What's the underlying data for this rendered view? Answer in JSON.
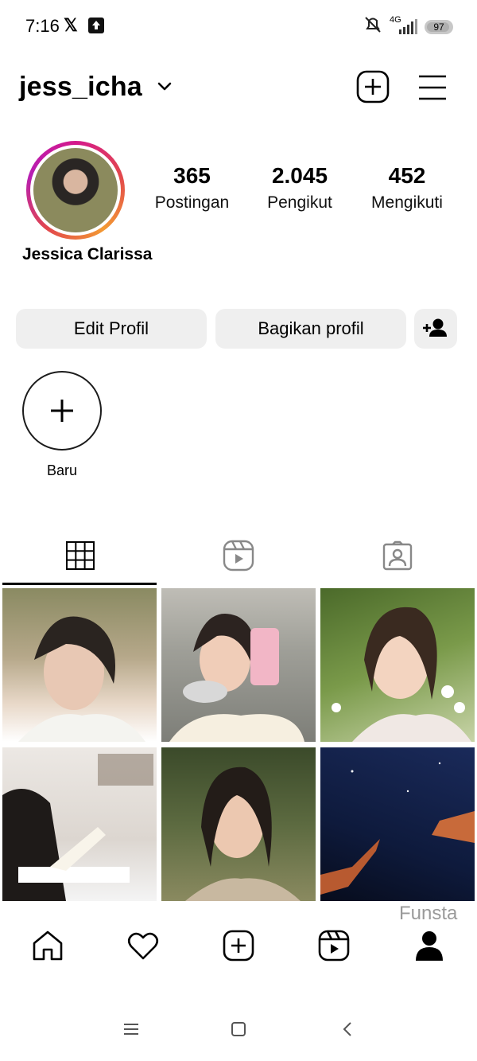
{
  "status_bar": {
    "time": "7:16",
    "x_glyph": "𝕏",
    "network": "4G",
    "battery": "97",
    "icons": [
      "x-icon",
      "upload-notification-icon",
      "mute-icon",
      "signal-icon",
      "battery-icon"
    ]
  },
  "header": {
    "username": "jess_icha"
  },
  "profile": {
    "display_name": "Jessica Clarissa",
    "stats": [
      {
        "value": "365",
        "label": "Postingan"
      },
      {
        "value": "2.045",
        "label": "Pengikut"
      },
      {
        "value": "452",
        "label": "Mengikuti"
      }
    ]
  },
  "actions": {
    "edit_label": "Edit Profil",
    "share_label": "Bagikan profil"
  },
  "highlights": {
    "new_label": "Baru"
  },
  "tabs": [
    "grid-icon",
    "reels-icon",
    "tagged-icon"
  ],
  "grid": {
    "posts": [
      {
        "name": "post-1"
      },
      {
        "name": "post-2"
      },
      {
        "name": "post-3"
      },
      {
        "name": "post-4"
      },
      {
        "name": "post-5"
      },
      {
        "name": "post-6"
      }
    ]
  },
  "watermark": "Funsta",
  "bottom_nav": [
    "home-icon",
    "heart-icon",
    "create-icon",
    "reels-icon",
    "profile-icon"
  ],
  "system_nav": [
    "menu-icon",
    "home-square-icon",
    "back-icon"
  ],
  "colors": {
    "story_ring": "#d4198c",
    "button_bg": "#efefef",
    "watermark": "#9a9a9a"
  }
}
